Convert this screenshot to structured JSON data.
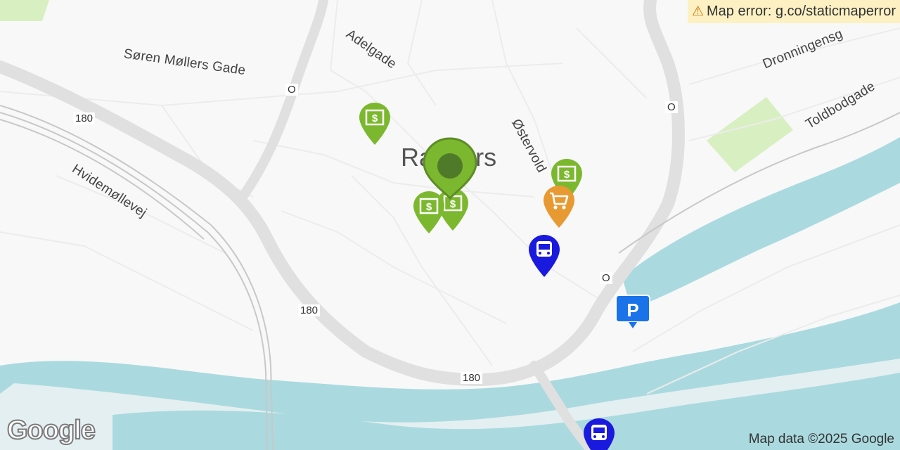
{
  "map": {
    "city_label": "Randers",
    "error_text": "Map error: g.co/staticmaperror",
    "attribution": "Map data ©2025 Google",
    "logo_text": "Google",
    "streets": {
      "soren_mollers": "Søren Møllers Gade",
      "adelgade": "Adelgade",
      "dronningensg": "Dronningensg",
      "toldbodgade": "Toldbodgade",
      "ostervold": "Østervold",
      "hvidemollevej": "Hvidemøllevej"
    },
    "road_numbers": {
      "r180_a": "180",
      "r180_b": "180",
      "r180_c": "180",
      "o_a": "O",
      "o_b": "O",
      "o_c": "O"
    },
    "colors": {
      "water": "#aadadf",
      "park": "#d8efc2",
      "road_major": "#e0e0e0",
      "bank_marker": "#7cb82f",
      "shop_marker": "#e89a32",
      "bus_marker": "#1a1adf",
      "parking_marker": "#1a73e8"
    },
    "markers": [
      {
        "type": "bank",
        "icon": "dollar-icon"
      },
      {
        "type": "bank",
        "icon": "dollar-icon"
      },
      {
        "type": "bank",
        "icon": "dollar-icon"
      },
      {
        "type": "bank",
        "icon": "dollar-icon"
      },
      {
        "type": "location",
        "icon": "location-pin-icon"
      },
      {
        "type": "shopping",
        "icon": "shopping-cart-icon"
      },
      {
        "type": "bus",
        "icon": "bus-icon"
      },
      {
        "type": "bus",
        "icon": "bus-icon"
      },
      {
        "type": "parking",
        "icon": "parking-icon"
      }
    ]
  }
}
